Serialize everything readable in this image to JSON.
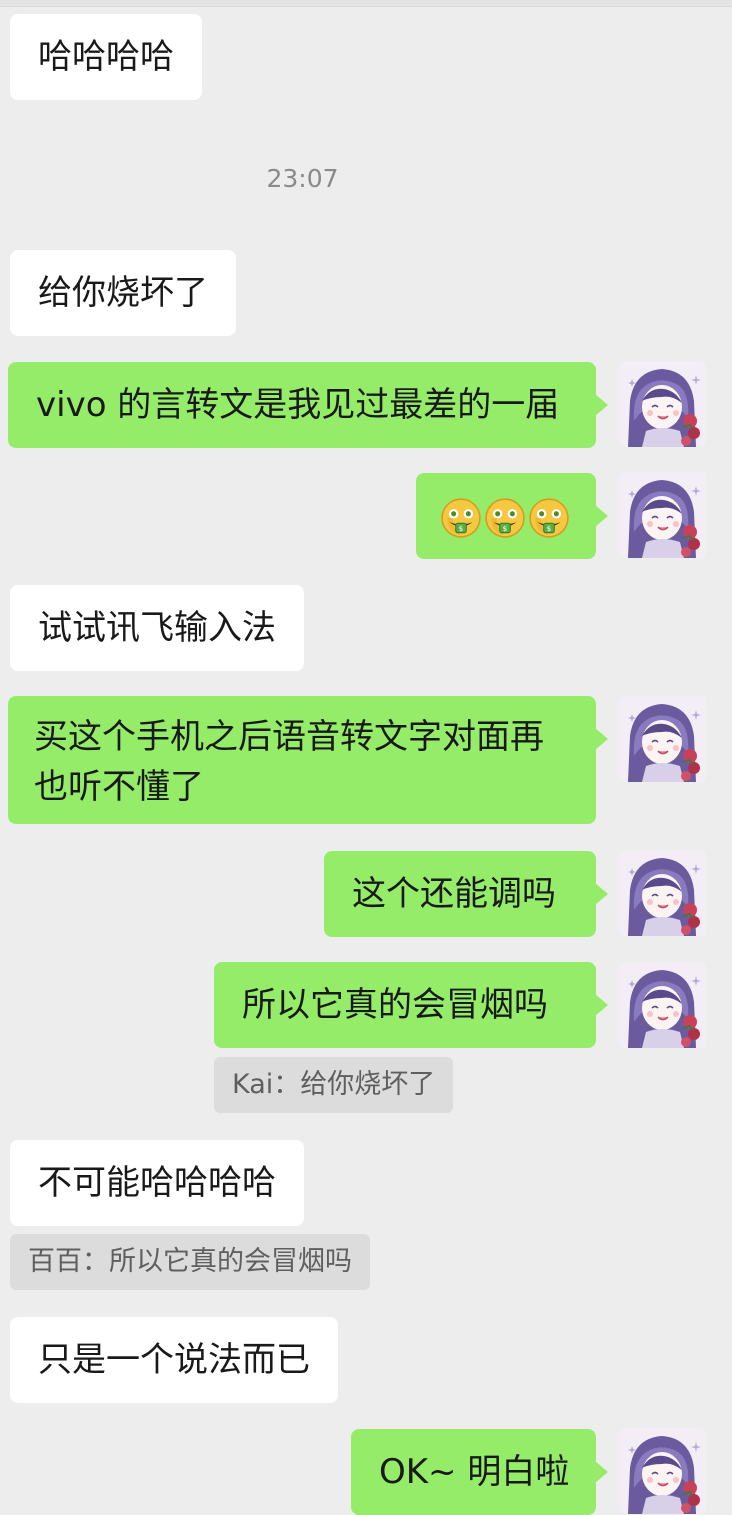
{
  "messages": [
    {
      "id": "m1",
      "side": "in",
      "text": "哈哈哈哈"
    },
    {
      "id": "t1",
      "type": "timestamp",
      "text": "23:07"
    },
    {
      "id": "m2",
      "side": "in",
      "text": "给你烧坏了"
    },
    {
      "id": "m3",
      "side": "out",
      "text": "vivo 的言转文是我见过最差的一届"
    },
    {
      "id": "m4",
      "side": "out",
      "emoji": [
        "money-mouth-face",
        "money-mouth-face",
        "money-mouth-face"
      ]
    },
    {
      "id": "m5",
      "side": "in",
      "text": "试试讯飞输入法"
    },
    {
      "id": "m6",
      "side": "out",
      "text": "买这个手机之后语音转文字对面再也听不懂了"
    },
    {
      "id": "m7",
      "side": "out",
      "text": "这个还能调吗"
    },
    {
      "id": "m8",
      "side": "out",
      "text": "所以它真的会冒烟吗",
      "quote": "Kai：给你烧坏了"
    },
    {
      "id": "m9",
      "side": "in",
      "text": "不可能哈哈哈哈",
      "quote": "百百：所以它真的会冒烟吗"
    },
    {
      "id": "m10",
      "side": "in",
      "text": "只是一个说法而已"
    },
    {
      "id": "m11",
      "side": "out",
      "text": "OK~ 明白啦"
    }
  ],
  "colors": {
    "background": "#ededed",
    "incoming_bubble": "#ffffff",
    "outgoing_bubble": "#95ec69",
    "quote_bg": "#dcdcdc",
    "timestamp": "#8a8a8a"
  },
  "avatar_icon": "anime-girl-avatar-icon"
}
